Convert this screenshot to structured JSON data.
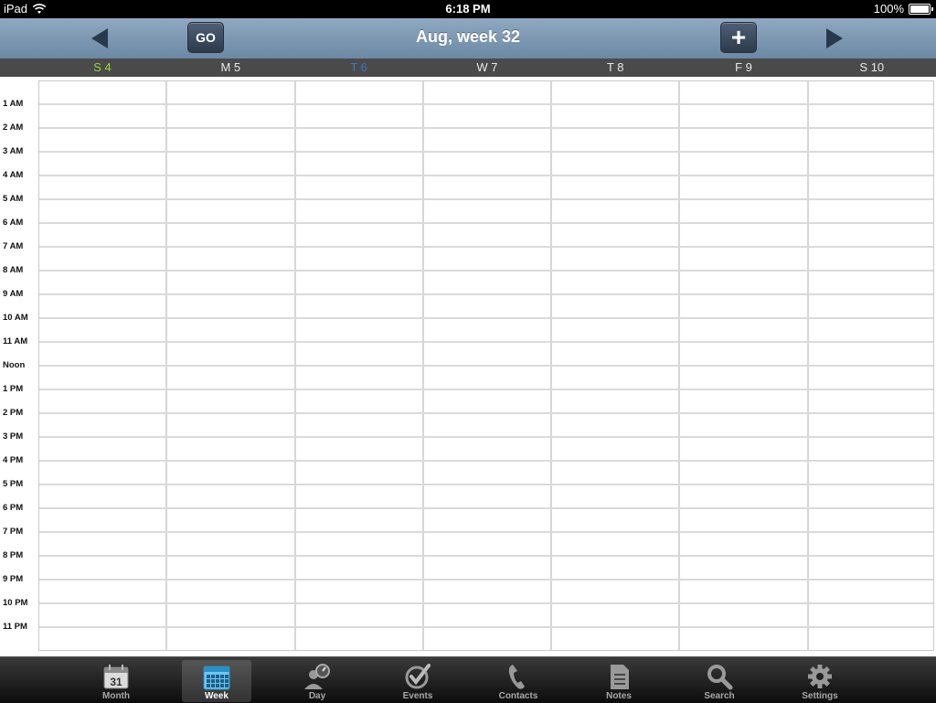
{
  "status": {
    "device": "iPad",
    "time": "6:18 PM",
    "battery": "100%"
  },
  "nav": {
    "go_label": "GO",
    "title": "Aug, week 32",
    "add_label": "+"
  },
  "days": [
    {
      "label": "S 4",
      "color": "#9bd63c"
    },
    {
      "label": "M 5",
      "color": "#e8e8e8"
    },
    {
      "label": "T 6",
      "color": "#3b78c8"
    },
    {
      "label": "W 7",
      "color": "#e8e8e8"
    },
    {
      "label": "T 8",
      "color": "#e8e8e8"
    },
    {
      "label": "F 9",
      "color": "#e8e8e8"
    },
    {
      "label": "S 10",
      "color": "#e8e8e8"
    }
  ],
  "hours": [
    "1 AM",
    "2 AM",
    "3 AM",
    "4 AM",
    "5 AM",
    "6 AM",
    "7 AM",
    "8 AM",
    "9 AM",
    "10 AM",
    "11 AM",
    "Noon",
    "1 PM",
    "2 PM",
    "3 PM",
    "4 PM",
    "5 PM",
    "6 PM",
    "7 PM",
    "8 PM",
    "9 PM",
    "10 PM",
    "11 PM"
  ],
  "tabs": [
    {
      "label": "Month",
      "icon": "calendar-month-icon",
      "active": false,
      "day_number": "31"
    },
    {
      "label": "Week",
      "icon": "calendar-week-icon",
      "active": true
    },
    {
      "label": "Day",
      "icon": "day-person-icon",
      "active": false
    },
    {
      "label": "Events",
      "icon": "checkmark-icon",
      "active": false
    },
    {
      "label": "Contacts",
      "icon": "phone-icon",
      "active": false
    },
    {
      "label": "Notes",
      "icon": "notes-icon",
      "active": false
    },
    {
      "label": "Search",
      "icon": "search-icon",
      "active": false
    },
    {
      "label": "Settings",
      "icon": "gear-icon",
      "active": false
    }
  ],
  "colors": {
    "nav_bar": "#7c97b3",
    "today_blue": "#3b78c8",
    "sunday_green": "#9bd63c"
  }
}
